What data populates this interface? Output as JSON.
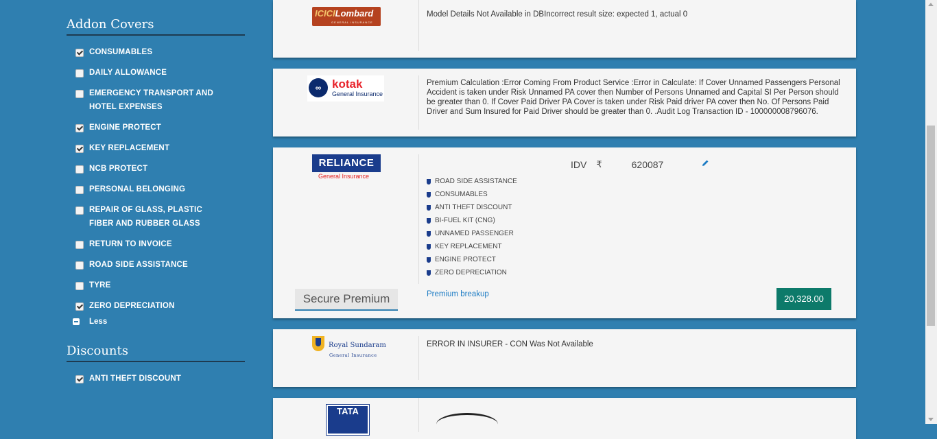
{
  "sidebar": {
    "addon_title": "Addon Covers",
    "addons": [
      {
        "label": "CONSUMABLES",
        "checked": true
      },
      {
        "label": "DAILY ALLOWANCE",
        "checked": false
      },
      {
        "label": "EMERGENCY TRANSPORT AND HOTEL EXPENSES",
        "checked": false
      },
      {
        "label": "ENGINE PROTECT",
        "checked": true
      },
      {
        "label": "KEY REPLACEMENT",
        "checked": true
      },
      {
        "label": "NCB PROTECT",
        "checked": false
      },
      {
        "label": "PERSONAL BELONGING",
        "checked": false
      },
      {
        "label": "REPAIR OF GLASS, PLASTIC FIBER AND RUBBER GLASS",
        "checked": false
      },
      {
        "label": "RETURN TO INVOICE",
        "checked": false
      },
      {
        "label": "ROAD SIDE ASSISTANCE",
        "checked": false
      },
      {
        "label": "TYRE",
        "checked": false
      },
      {
        "label": "ZERO DEPRECIATION",
        "checked": true
      }
    ],
    "less_label": "Less",
    "discount_title": "Discounts",
    "discounts": [
      {
        "label": "ANTI THEFT DISCOUNT",
        "checked": true
      }
    ]
  },
  "cards": {
    "icici": {
      "logo_text_a": "ICICI",
      "logo_text_b": "Lombard",
      "logo_sub": "GENERAL INSURANCE",
      "message": "Model Details Not Available in DBIncorrect result size: expected 1, actual 0"
    },
    "kotak": {
      "logo_mark": "∞",
      "logo_text": "kotak",
      "logo_sub": "General Insurance",
      "message": "Premium Calculation :Error Coming From Product Service :Error in Calculate: If Cover Unnamed Passengers Personal Accident is taken under Risk Unnamed PA cover then Number of Persons Unnamed and Capital SI Per Person should be greater than 0. If Cover Paid Driver PA Cover is taken under Risk Paid driver PA cover then No. Of Persons Paid Driver and Sum Insured for Paid Driver should be greater than 0. .Audit Log Transaction ID - 100000008796076."
    },
    "reliance": {
      "logo_text": "RELIANCE",
      "logo_sub": "General Insurance",
      "idv_label": "IDV",
      "currency": "₹",
      "idv_value": "620087",
      "features": [
        "ROAD SIDE ASSISTANCE",
        "CONSUMABLES",
        "ANTI THEFT DISCOUNT",
        "BI-FUEL KIT (CNG)",
        "UNNAMED PASSENGER",
        "KEY REPLACEMENT",
        "ENGINE PROTECT",
        "ZERO DEPRECIATION"
      ],
      "secure_label": "Secure Premium",
      "breakup_label": "Premium breakup",
      "premium": "20,328.00"
    },
    "royal": {
      "logo_text": "Royal Sundaram",
      "logo_sub": "General Insurance",
      "message": "ERROR IN INSURER - CON Was Not Available"
    },
    "tata": {
      "logo_text": "TATA"
    }
  }
}
